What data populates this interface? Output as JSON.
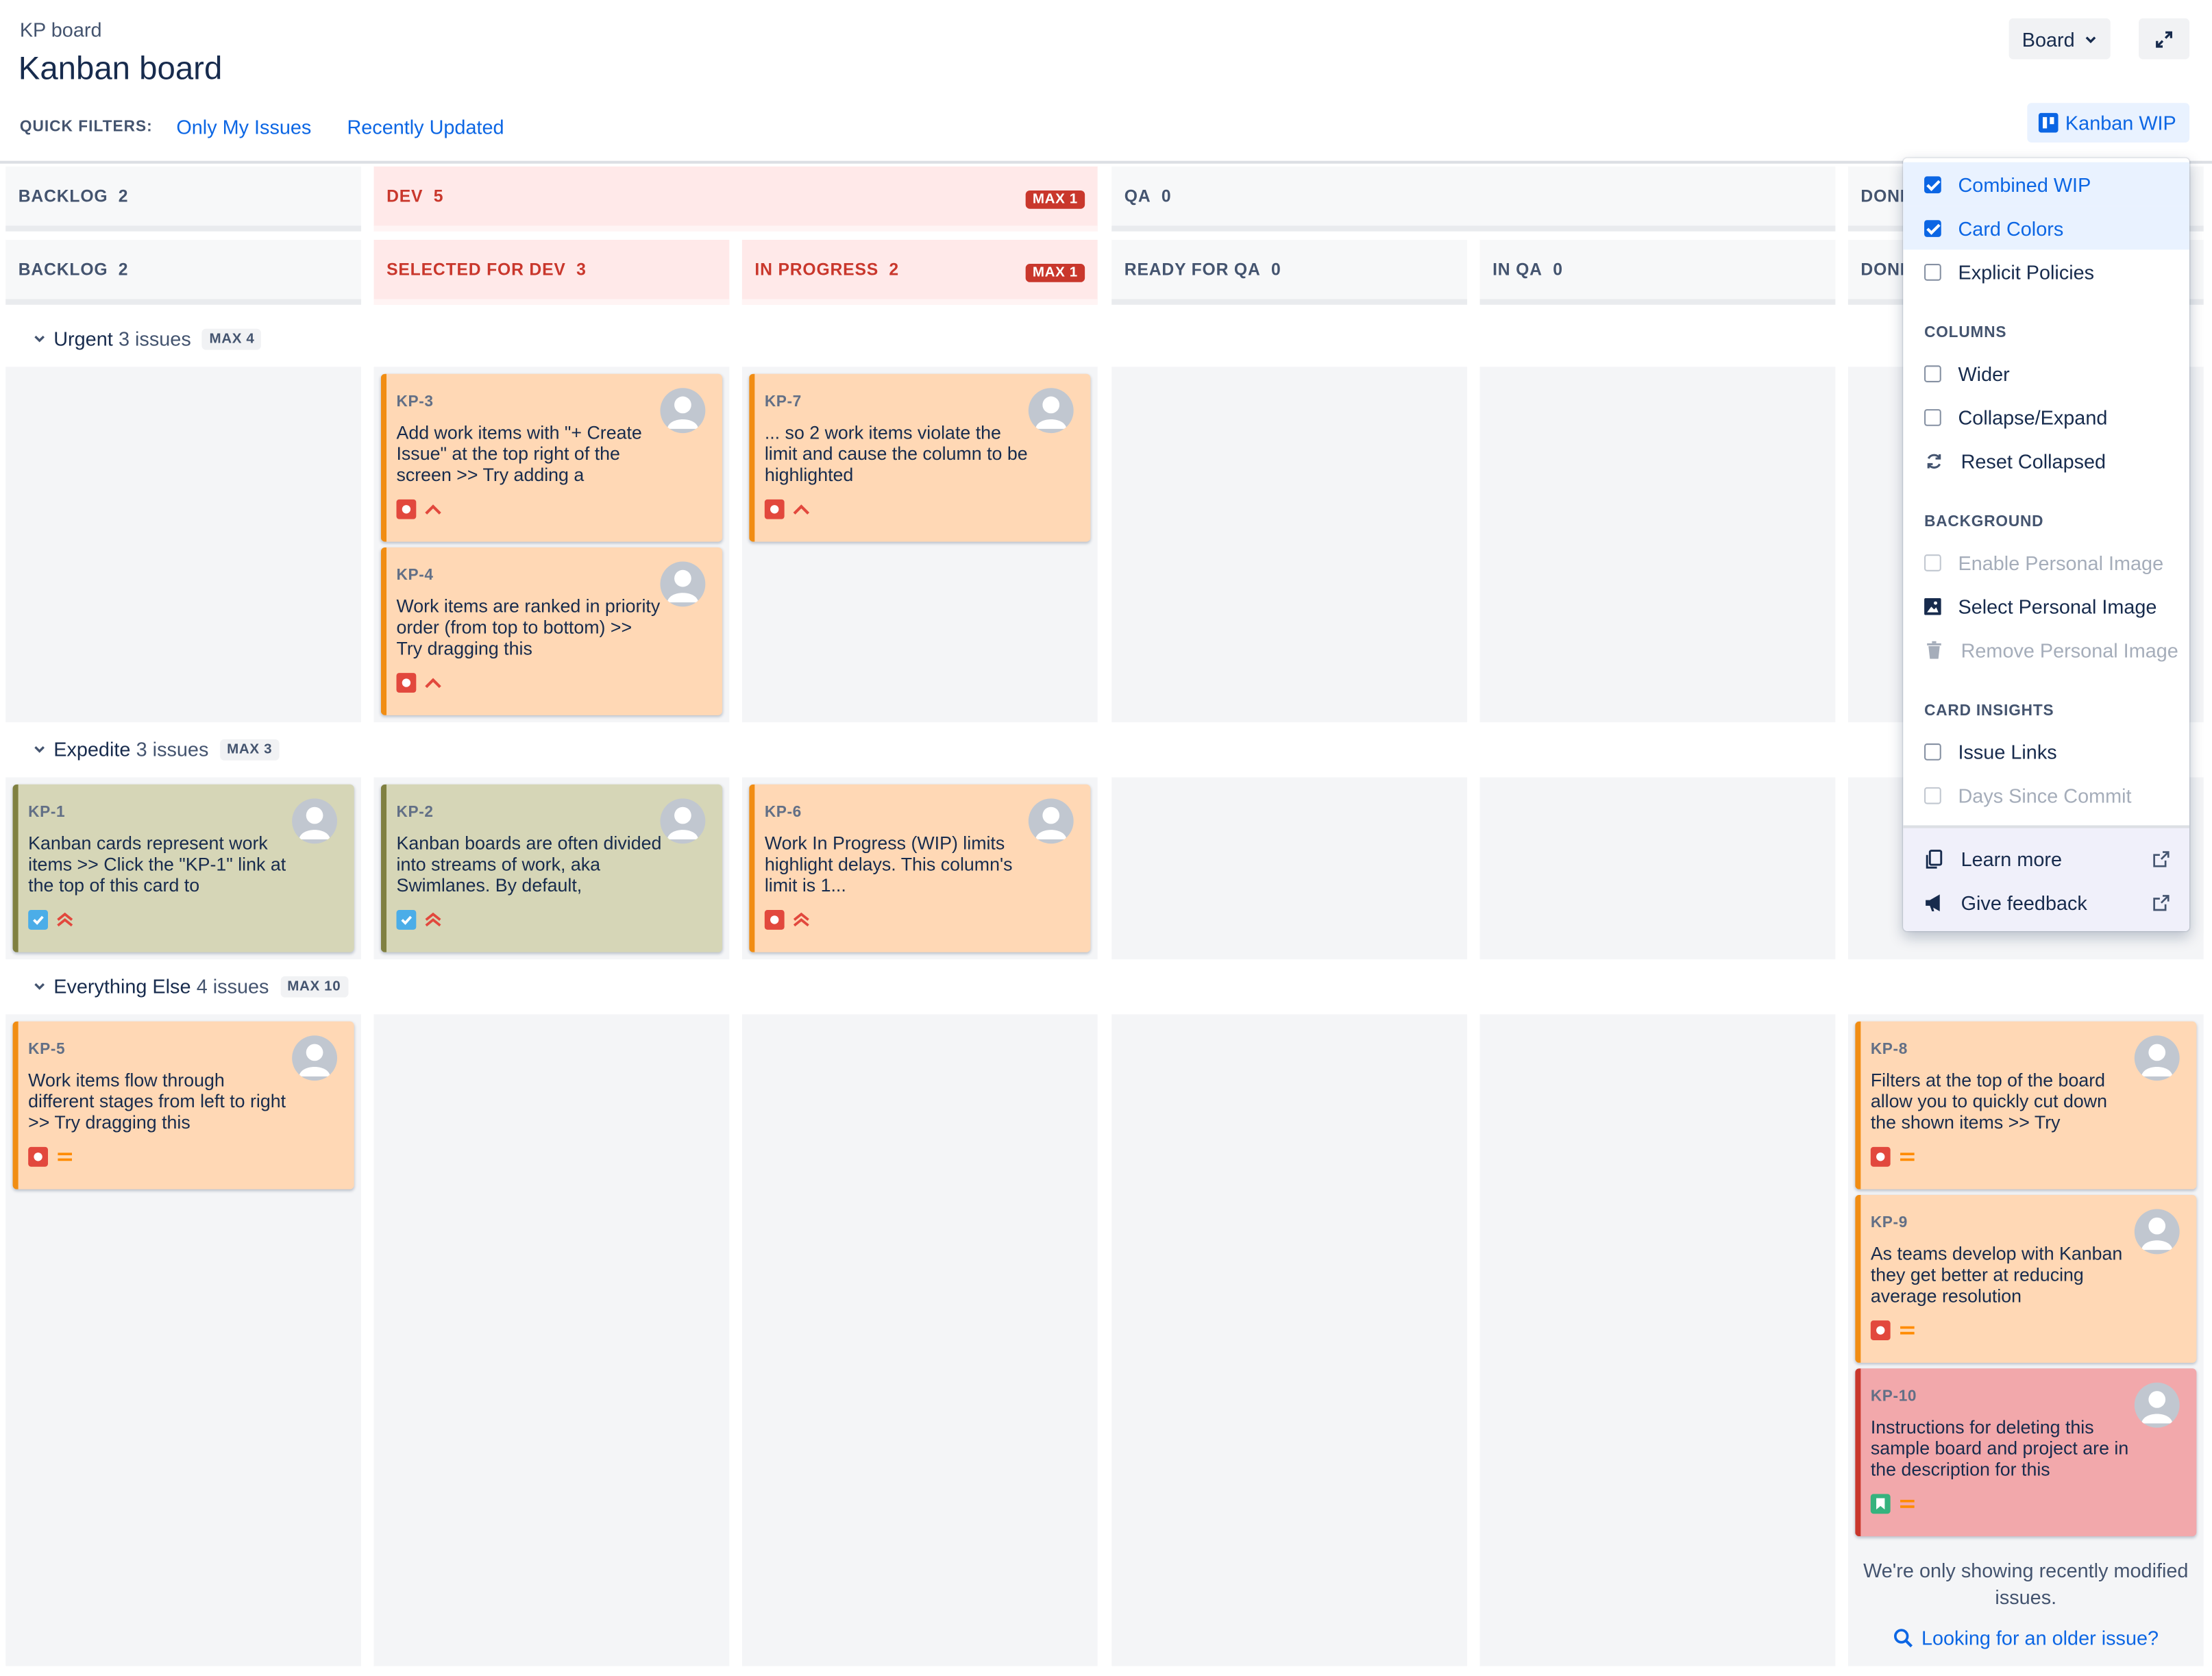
{
  "header": {
    "breadcrumb": "KP board",
    "title": "Kanban board",
    "board_button": "Board",
    "kanban_wip_button": "Kanban WIP"
  },
  "quick_filters": {
    "label": "QUICK FILTERS:",
    "items": [
      "Only My Issues",
      "Recently Updated"
    ]
  },
  "columns_top": [
    {
      "name": "BACKLOG",
      "count": "2"
    },
    {
      "name": "DEV",
      "count": "5",
      "max": "MAX 1"
    },
    {
      "name": "QA",
      "count": "0"
    },
    {
      "name": "DONE",
      "count": ""
    }
  ],
  "columns_sub": [
    {
      "name": "BACKLOG",
      "count": "2"
    },
    {
      "name": "SELECTED FOR DEV",
      "count": "3"
    },
    {
      "name": "IN PROGRESS",
      "count": "2",
      "max": "MAX 1"
    },
    {
      "name": "READY FOR QA",
      "count": "0"
    },
    {
      "name": "IN QA",
      "count": "0"
    },
    {
      "name": "DONE",
      "count": ""
    }
  ],
  "swimlanes": [
    {
      "name": "Urgent",
      "count": "3 issues",
      "max": "MAX 4"
    },
    {
      "name": "Expedite",
      "count": "3 issues",
      "max": "MAX 3"
    },
    {
      "name": "Everything Else",
      "count": "4 issues",
      "max": "MAX 10"
    }
  ],
  "cards": {
    "kp3": {
      "key": "KP-3",
      "text": "Add work items with \"+ Create Issue\" at the top right of the screen >> Try adding a"
    },
    "kp4": {
      "key": "KP-4",
      "text": "Work items are ranked in priority order (from top to bottom) >> Try dragging this"
    },
    "kp7": {
      "key": "KP-7",
      "text": "... so 2 work items violate the limit and cause the column to be highlighted"
    },
    "kp1": {
      "key": "KP-1",
      "text": "Kanban cards represent work items >> Click the \"KP-1\" link at the top of this card to"
    },
    "kp2": {
      "key": "KP-2",
      "text": "Kanban boards are often divided into streams of work, aka Swimlanes. By default,"
    },
    "kp6": {
      "key": "KP-6",
      "text": "Work In Progress (WIP) limits highlight delays. This column's limit is 1..."
    },
    "kp5": {
      "key": "KP-5",
      "text": "Work items flow through different stages from left to right >> Try dragging this"
    },
    "kp8": {
      "key": "KP-8",
      "text": "Filters at the top of the board allow you to quickly cut down the shown items >> Try"
    },
    "kp9": {
      "key": "KP-9",
      "text": "As teams develop with Kanban they get better at reducing average resolution"
    },
    "kp10": {
      "key": "KP-10",
      "text": "Instructions for deleting this sample board and project are in the description for this"
    }
  },
  "menu": {
    "combined_wip": "Combined WIP",
    "card_colors": "Card Colors",
    "explicit_policies": "Explicit Policies",
    "columns_section": "COLUMNS",
    "wider": "Wider",
    "collapse_expand": "Collapse/Expand",
    "reset_collapsed": "Reset Collapsed",
    "background_section": "BACKGROUND",
    "enable_personal_image": "Enable Personal Image",
    "select_personal_image": "Select Personal Image",
    "remove_personal_image": "Remove Personal Image",
    "card_insights_section": "CARD INSIGHTS",
    "issue_links": "Issue Links",
    "days_since_commit": "Days Since Commit",
    "learn_more": "Learn more",
    "give_feedback": "Give feedback"
  },
  "footer": {
    "note": "We're only showing recently modified issues.",
    "older_link": "Looking for an older issue?"
  },
  "colors": {
    "accent": "#0c66e4",
    "wip_exceeded": "#c9372c",
    "card_orange": "#ffd8b5",
    "card_olive": "#d6d6b7",
    "card_red": "#f2a8ab"
  }
}
